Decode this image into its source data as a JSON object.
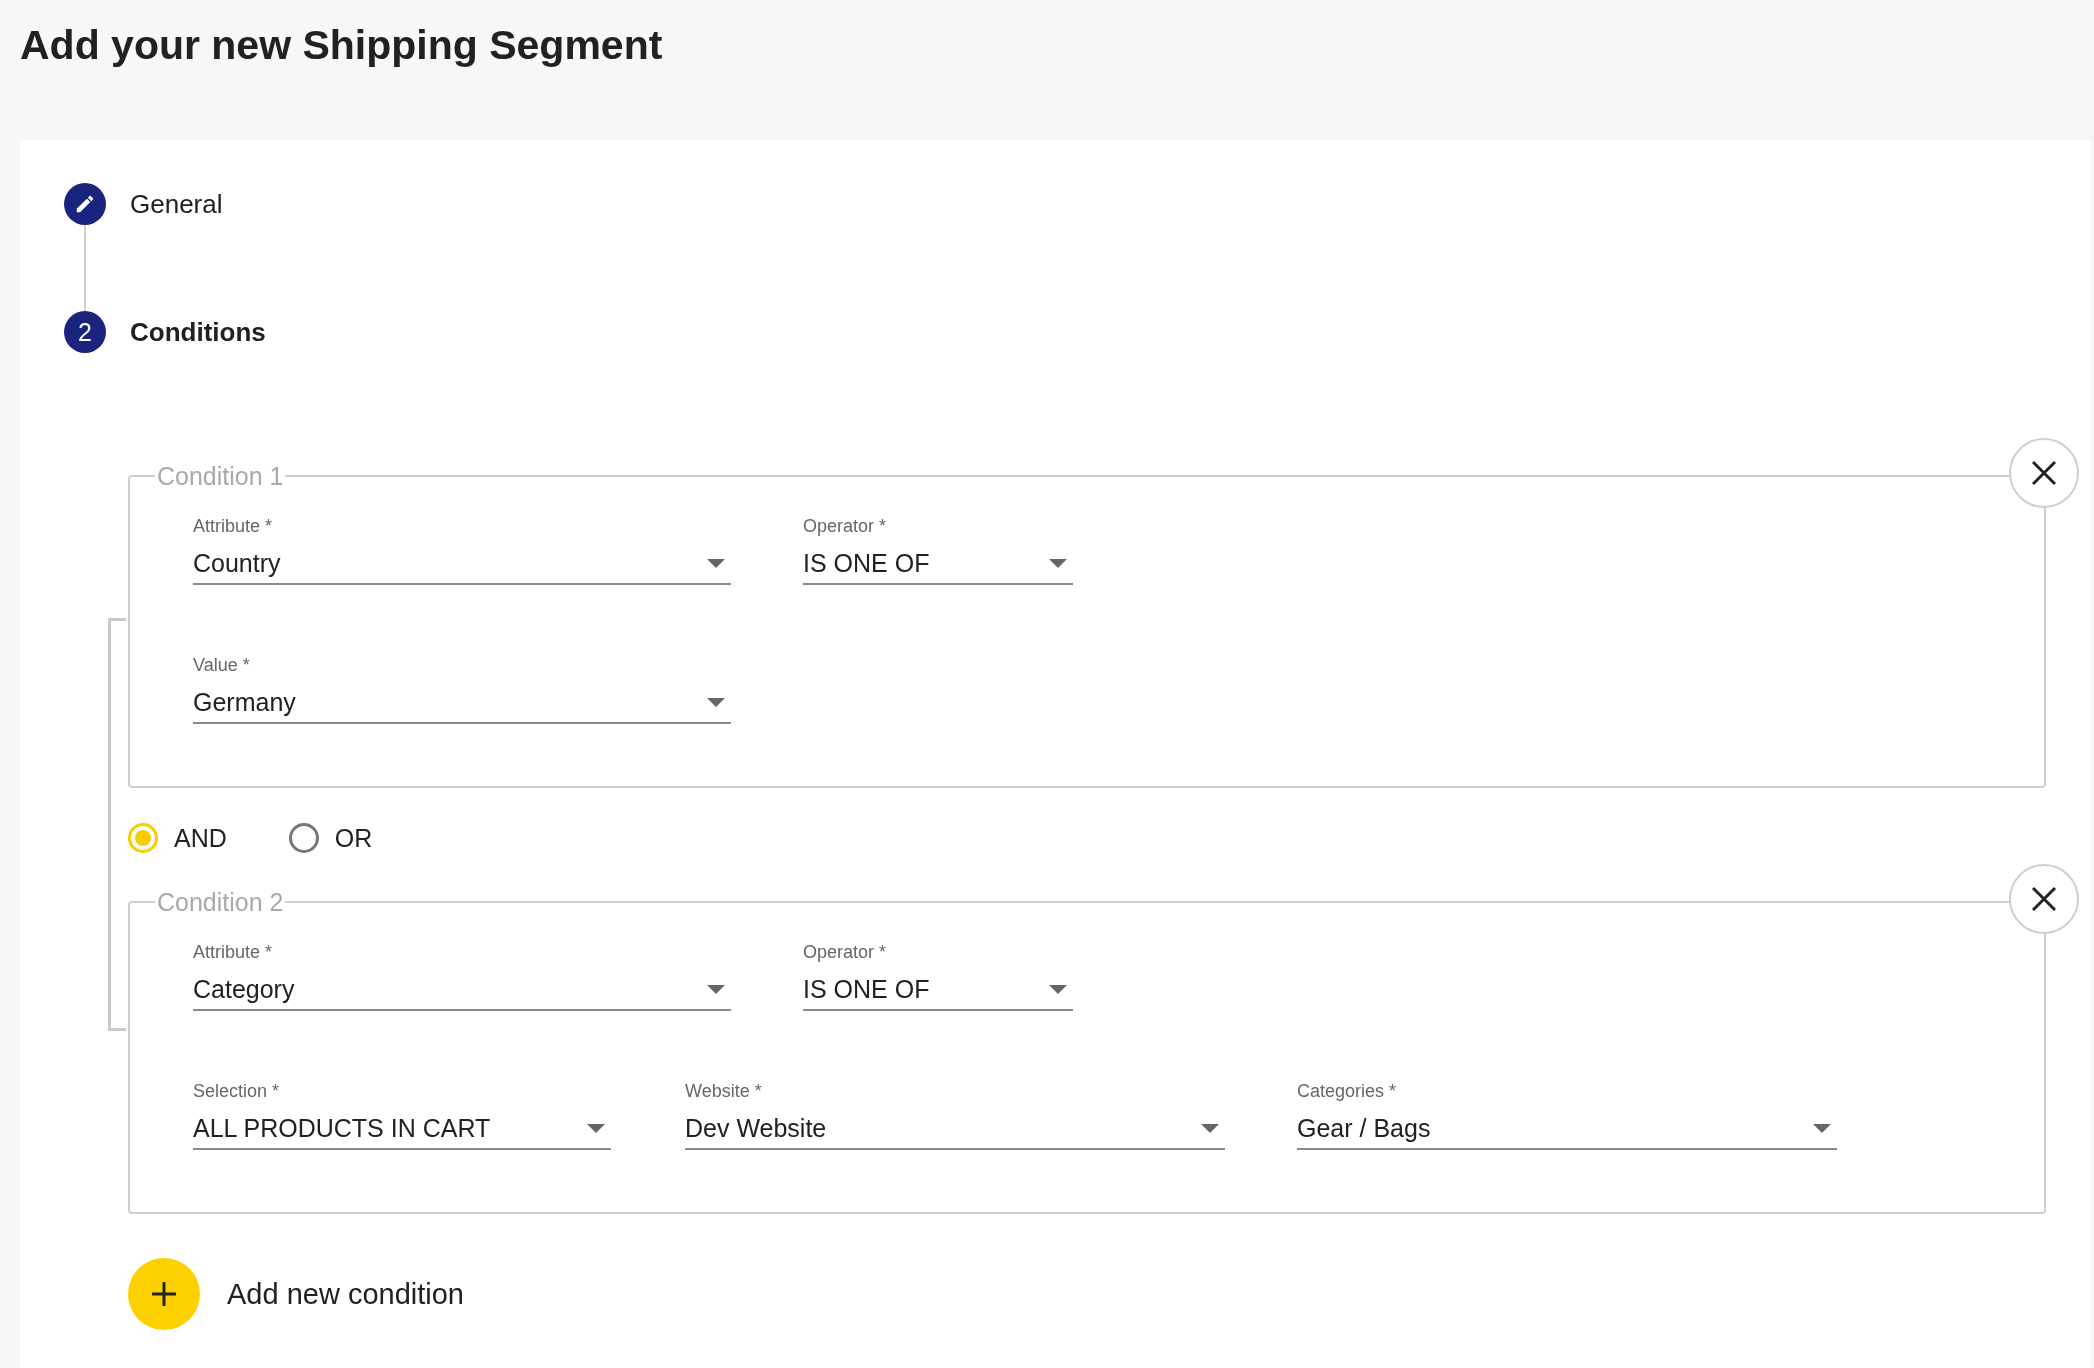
{
  "title": "Add your new Shipping Segment",
  "steps": [
    {
      "kind": "edit",
      "label": "General",
      "selected": false
    },
    {
      "kind": "number",
      "number": "2",
      "label": "Conditions",
      "selected": true
    }
  ],
  "conditions": [
    {
      "legend": "Condition 1",
      "rows": [
        [
          {
            "label": "Attribute *",
            "value": "Country"
          },
          {
            "label": "Operator *",
            "value": "IS ONE OF"
          }
        ],
        [
          {
            "label": "Value *",
            "value": "Germany"
          }
        ]
      ]
    },
    {
      "legend": "Condition 2",
      "rows": [
        [
          {
            "label": "Attribute *",
            "value": "Category"
          },
          {
            "label": "Operator *",
            "value": "IS ONE OF"
          }
        ],
        [
          {
            "label": "Selection *",
            "value": "ALL PRODUCTS IN CART"
          },
          {
            "label": "Website *",
            "value": "Dev Website"
          },
          {
            "label": "Categories *",
            "value": "Gear / Bags"
          }
        ]
      ]
    }
  ],
  "logic": [
    {
      "label": "AND",
      "selected": true
    },
    {
      "label": "OR",
      "selected": false
    }
  ],
  "add_button": {
    "label": "Add new condition"
  }
}
